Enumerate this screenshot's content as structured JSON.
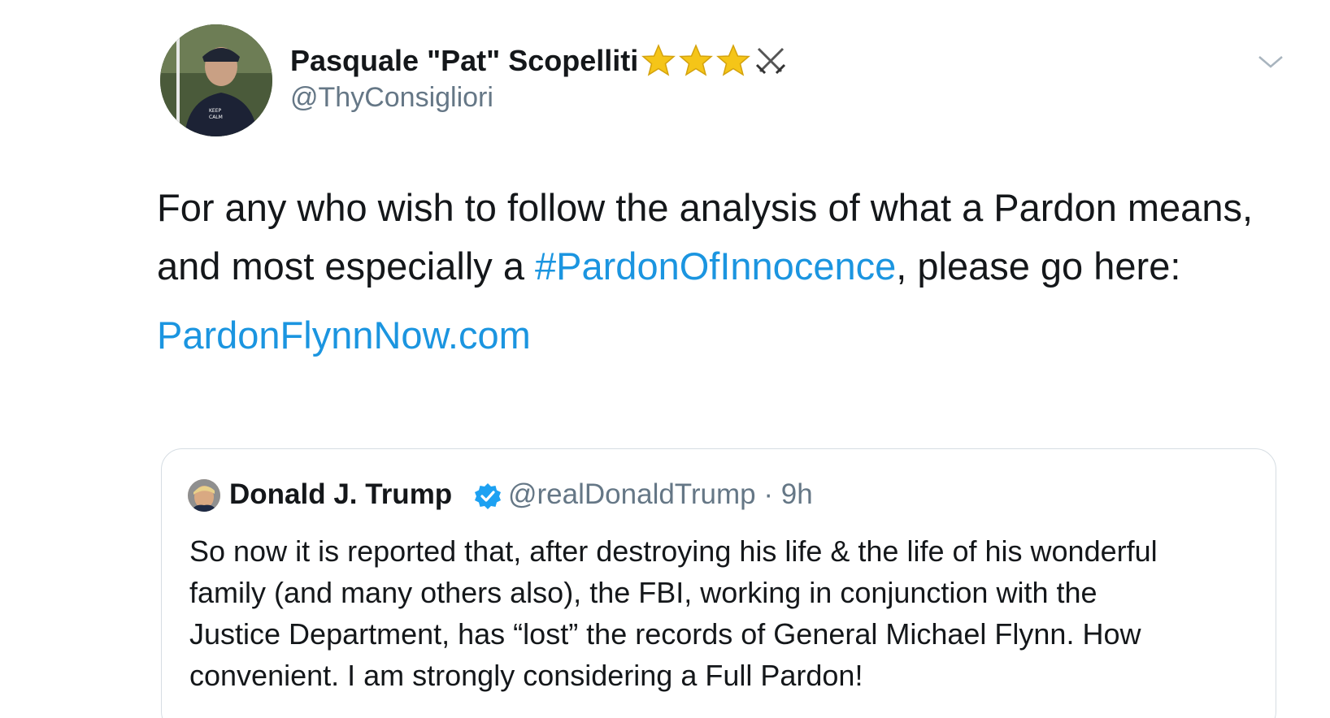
{
  "author": {
    "display_name": "Pasquale \"Pat\" Scopelliti",
    "handle": "@ThyConsigliori",
    "name_emojis": [
      "star-emoji",
      "star-emoji",
      "star-emoji",
      "crossed-swords-emoji"
    ]
  },
  "tweet": {
    "line1": "For any who wish to follow the analysis of what a Pardon means,",
    "line2_before": "and most especially a ",
    "hashtag": "#PardonOfInnocence",
    "line2_after": ", please go here:",
    "url": "PardonFlynnNow.com"
  },
  "quoted": {
    "display_name": "Donald J. Trump",
    "handle": "@realDonaldTrump",
    "separator": "·",
    "time": "9h",
    "lines": [
      "So now it is reported that, after destroying his life & the life of his wonderful",
      "family (and many others also), the FBI, working in conjunction with the",
      "Justice Department, has “lost” the records of General Michael Flynn. How",
      "convenient. I am strongly considering a Full Pardon!"
    ]
  },
  "colors": {
    "link": "#1b95e0",
    "secondary_text": "#657786",
    "primary_text": "#14171a",
    "border": "#d6dde3",
    "verified": "#1da1f2",
    "star": "#f5c518"
  }
}
